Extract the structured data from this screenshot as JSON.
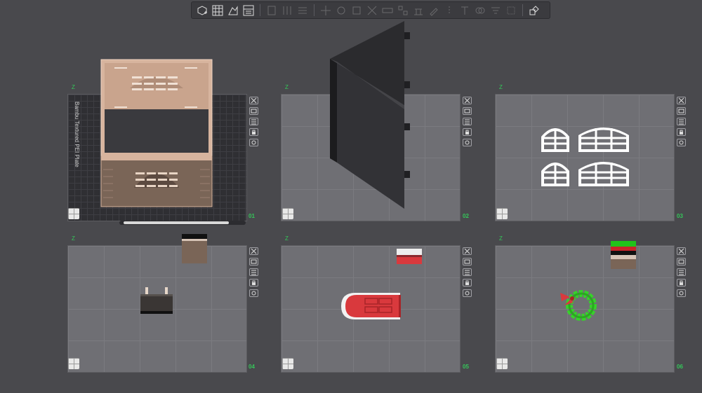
{
  "toolbar": {
    "icons": [
      "add-plate-icon",
      "arrange-grid-icon",
      "auto-orient-icon",
      "plate-settings-icon",
      "layer-icon",
      "split-icon",
      "list-icon",
      "move-icon",
      "rotate-icon",
      "scale-icon",
      "cut-icon",
      "measure-icon",
      "assembly-icon",
      "support-icon",
      "paint-icon",
      "seam-icon",
      "text-icon",
      "mesh-boolean-icon",
      "variable-layer-icon",
      "fuzzy-icon",
      "shapes-icon"
    ]
  },
  "plates": [
    {
      "number": "01",
      "axis": "Z",
      "label": "Bambu Textured PEI Plate"
    },
    {
      "number": "02",
      "axis": "Z"
    },
    {
      "number": "03",
      "axis": "Z"
    },
    {
      "number": "04",
      "axis": "Z"
    },
    {
      "number": "05",
      "axis": "Z"
    },
    {
      "number": "06",
      "axis": "Z"
    }
  ],
  "colors": {
    "background": "#49494d",
    "plate": "#6f6f74",
    "accent": "#34c759",
    "wall_pink": "#d7b49e",
    "wall_dark": "#2a2a2a",
    "door_red": "#d9393d",
    "wreath_green": "#37d12b"
  }
}
